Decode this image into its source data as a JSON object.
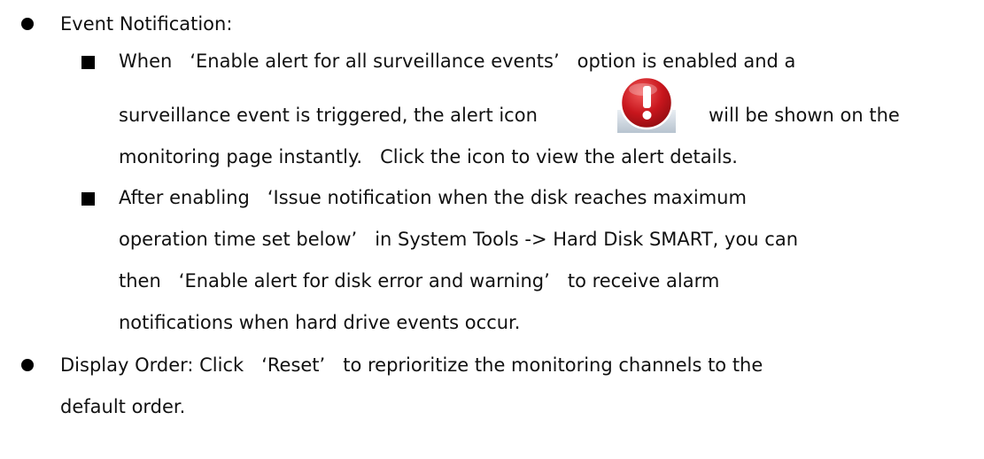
{
  "section1": {
    "title": "Event Notification:",
    "item1": {
      "line1": "When   ‘Enable alert for all surveillance events’   option is enabled and a",
      "line2_before_icon": "surveillance event is triggered, the alert icon",
      "line2_after_icon": "will be shown on the",
      "line3": "monitoring page instantly.   Click the icon to view the alert details."
    },
    "item2": {
      "line1": "After enabling   ‘Issue notification when the disk reaches maximum",
      "line2": "operation time set below’   in System Tools -> Hard Disk SMART, you can",
      "line3": "then   ‘Enable alert for disk error and warning’   to receive alarm",
      "line4": "notifications when hard drive events occur."
    }
  },
  "section2": {
    "line1": "Display Order: Click   ‘Reset’   to reprioritize the monitoring channels to the",
    "line2": "default order."
  },
  "icons": {
    "alert": "alert-icon"
  },
  "colors": {
    "alert_red": "#c8161d",
    "text": "#111111"
  }
}
